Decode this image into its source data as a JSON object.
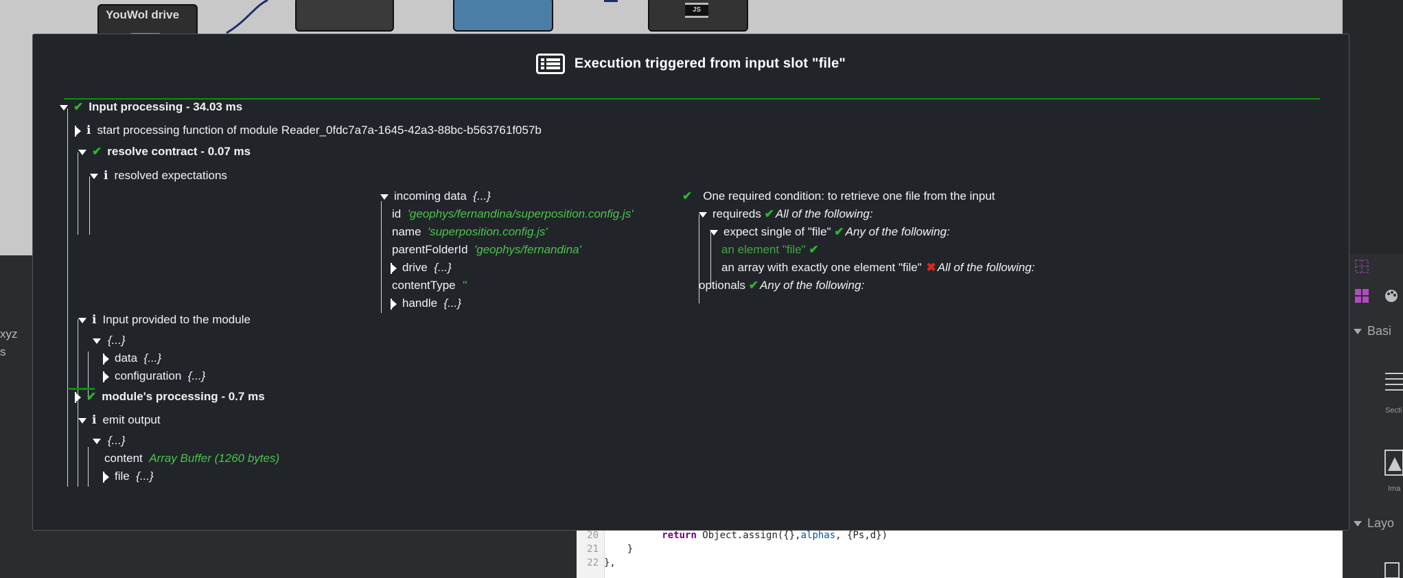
{
  "background": {
    "modules": [
      "YouWol drive",
      "JS"
    ],
    "side_text": [
      "xyz",
      "s"
    ],
    "right_panel": {
      "basic_label": "Basi",
      "section_label": "Secti",
      "image_label": "Ima",
      "layout_label": "Layo"
    },
    "code_lines": [
      {
        "num": "20",
        "keyword": "return",
        "rest_a": " Object.assign({},",
        "var": "alphas",
        "rest_b": ", {Ps,d})"
      },
      {
        "num": "21",
        "text": "    }"
      },
      {
        "num": "22",
        "text": "},"
      }
    ]
  },
  "modal": {
    "title": "Execution triggered from input slot \"file\"",
    "input_processing": "Input processing - 34.03 ms",
    "start_processing": "start processing function of module Reader_0fdc7a7a-1645-42a3-88bc-b563761f057b",
    "resolve_contract": "resolve contract - 0.07 ms",
    "resolved_expectations": "resolved expectations",
    "incoming": {
      "label": "incoming data",
      "summary": "{...}",
      "fields": [
        {
          "key": "id",
          "value": "'geophys/fernandina/superposition.config.js'"
        },
        {
          "key": "name",
          "value": "'superposition.config.js'"
        },
        {
          "key": "parentFolderId",
          "value": "'geophys/fernandina'"
        },
        {
          "key": "drive",
          "value": "{...}"
        },
        {
          "key": "contentType",
          "value": "''"
        },
        {
          "key": "handle",
          "value": "{...}"
        }
      ]
    },
    "expectations": {
      "required_condition": "One required condition: to retrieve one file from the input",
      "requireds_label": "requireds",
      "requireds_desc": "All of the following:",
      "expect_single": "expect single of \"file\"",
      "expect_single_desc": "Any of the following:",
      "an_element": "an element \"file\"",
      "an_array": "an array with exactly one element \"file\"",
      "an_array_desc": "All of the following:",
      "optionals_label": "optionals",
      "optionals_desc": "Any of the following:"
    },
    "input_provided": "Input provided to the module",
    "input_obj": "{...}",
    "data_label": "data",
    "data_value": "{...}",
    "configuration_label": "configuration",
    "configuration_value": "{...}",
    "modules_processing": "module's processing - 0.7 ms",
    "emit_output": "emit output",
    "output_obj": "{...}",
    "content_label": "content",
    "content_value": "Array Buffer (1260 bytes)",
    "file_label": "file",
    "file_value": "{...}"
  }
}
